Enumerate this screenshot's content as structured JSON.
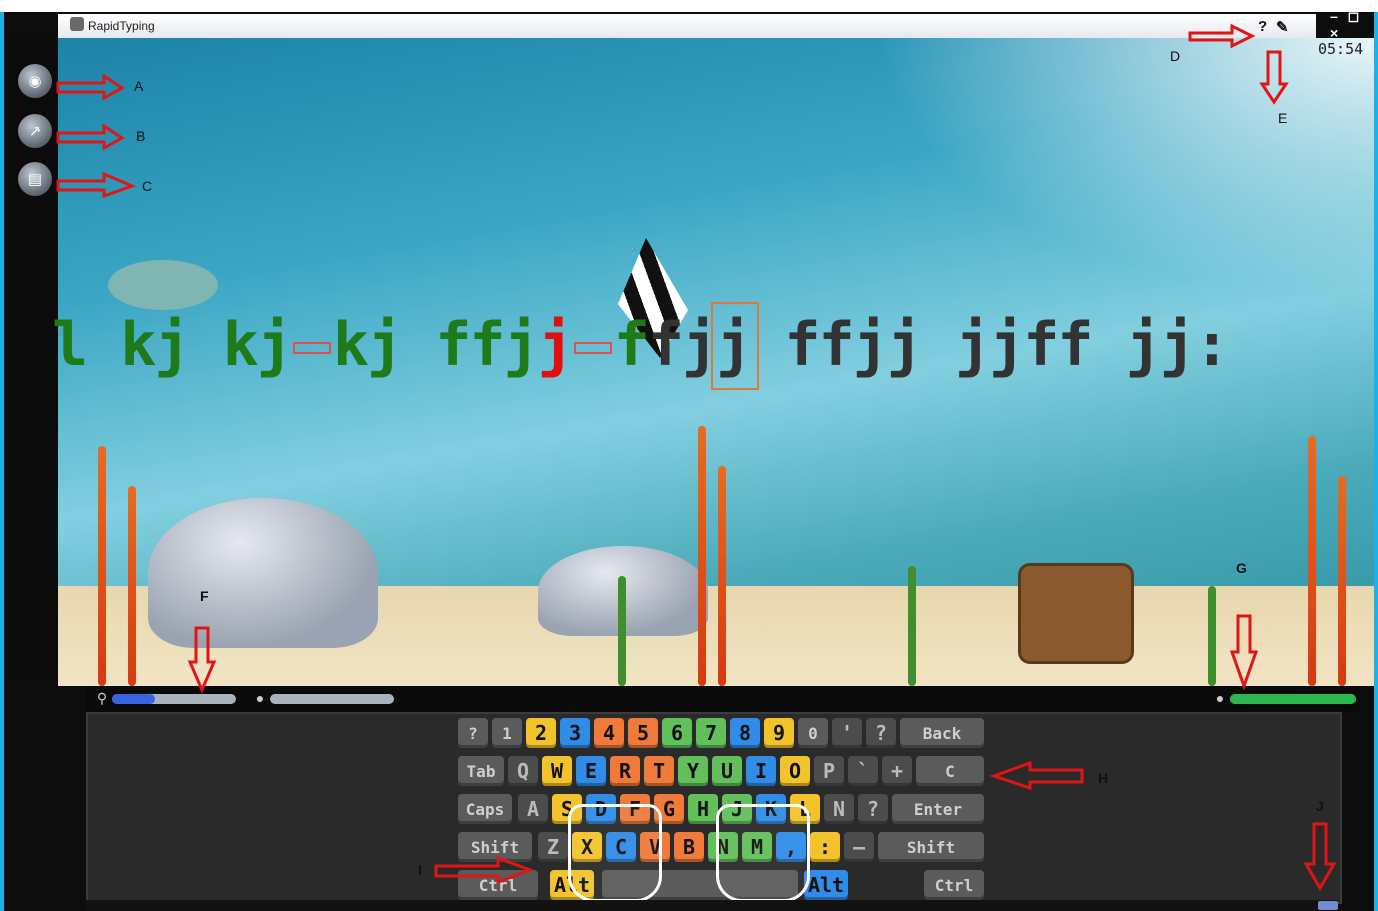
{
  "window": {
    "title": "RapidTyping",
    "controls": "– ◻ ×"
  },
  "toolbar": {
    "help_label": "?",
    "settings_icon": "wrench-icon",
    "timer": "05:54"
  },
  "sidebar": {
    "items": [
      {
        "icon": "home-icon",
        "label": "A"
      },
      {
        "icon": "stats-icon",
        "label": "B"
      },
      {
        "icon": "editor-icon",
        "label": "C"
      }
    ]
  },
  "lesson": {
    "typed_prefix": "l kj kj",
    "typed_mid": "kj  ffj",
    "error_char": "j",
    "typed_after_error": "f",
    "current_char": "f",
    "remaining": "jj ffjj jjff jj:"
  },
  "annotations": {
    "A": "A",
    "B": "B",
    "C": "C",
    "D": "D",
    "E": "E",
    "F": "F",
    "G": "G",
    "H": "H",
    "I": "I",
    "J": "J"
  },
  "status": {
    "progress_fraction": 0.35,
    "accuracy_fraction": 1.0
  },
  "keyboard": {
    "row1": [
      "?",
      "1",
      "2",
      "3",
      "4",
      "5",
      "6",
      "7",
      "8",
      "9",
      "0",
      "'",
      "?",
      "Back"
    ],
    "row2": [
      "Tab",
      "Q",
      "W",
      "E",
      "R",
      "T",
      "Y",
      "U",
      "I",
      "O",
      "P",
      "`",
      "+",
      "C"
    ],
    "row3": [
      "Caps",
      "A",
      "S",
      "D",
      "F",
      "G",
      "H",
      "J",
      "K",
      "L",
      "N",
      "?",
      "Enter"
    ],
    "row4": [
      "Shift",
      "Z",
      "X",
      "C",
      "V",
      "B",
      "N",
      "M",
      ",",
      ":",
      "—",
      "Shift"
    ],
    "row5": [
      "Ctrl",
      "Alt",
      "",
      "Alt",
      "Ctrl"
    ]
  }
}
